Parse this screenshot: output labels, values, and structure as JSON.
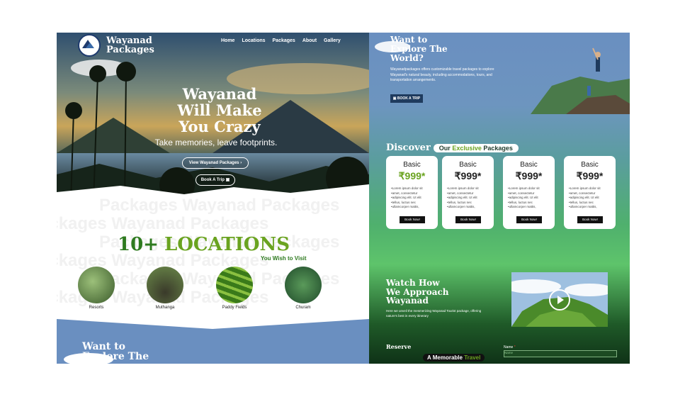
{
  "brand": {
    "name_line1": "Wayanad",
    "name_line2": "Packages"
  },
  "nav": [
    "Home",
    "Locations",
    "Packages",
    "About",
    "Gallery"
  ],
  "hero": {
    "title_line1": "Wayanad",
    "title_line2": "Will Make",
    "title_line3": "You Crazy",
    "subtitle": "Take memories, leave footprints.",
    "view_button": "View Wayanad Packages",
    "book_button": "Book A Trip"
  },
  "locations": {
    "watermark": "Packages Wayanad Packages",
    "count": "10+",
    "word": "LOCATIONS",
    "tagline": "You Wish to Visit",
    "items": [
      {
        "label": "Resorts",
        "color": "#5c8a4a"
      },
      {
        "label": "Muthanga",
        "color": "#6b6a3a"
      },
      {
        "label": "Paddy Fields",
        "color": "#4f8a2a"
      },
      {
        "label": "Churam",
        "color": "#2f6a3a"
      }
    ]
  },
  "left_footer_title": {
    "line1": "Want to",
    "line2": "Explore The"
  },
  "explore": {
    "title_line1": "Want to",
    "title_line2": "Explore The",
    "title_line3": "World?",
    "description": "Wayanadpackages offers customizable travel packages to explore Wayanad's natural beauty, including accommodations, tours, and transportation arrangements.",
    "button": "BOOK A TRIP"
  },
  "discover": {
    "word": "Discover",
    "pill_our": "Our",
    "pill_exclusive": "Exclusive",
    "pill_packages": "Packages"
  },
  "packages": [
    {
      "title": "Basic",
      "price": "₹999*",
      "price_color": "#6aa320",
      "features": [
        "Lorem ipsum dolor sit",
        "amet, consectetur",
        "adipiscing elit. Ut elit",
        "tellus, luctus nec",
        "ullamcorper mattis,"
      ],
      "button": "Book Now!"
    },
    {
      "title": "Basic",
      "price": "₹999*",
      "price_color": "#222222",
      "features": [
        "Lorem ipsum dolor sit",
        "amet, consectetur",
        "adipiscing elit. Ut elit",
        "tellus, luctus nec",
        "ullamcorper mattis,"
      ],
      "button": "Book Now!"
    },
    {
      "title": "Basic",
      "price": "₹999*",
      "price_color": "#222222",
      "features": [
        "Lorem ipsum dolor sit",
        "amet, consectetur",
        "adipiscing elit. Ut elit",
        "tellus, luctus nec",
        "ullamcorper mattis,"
      ],
      "button": "Book Now!"
    },
    {
      "title": "Basic",
      "price": "₹999*",
      "price_color": "#222222",
      "features": [
        "Lorem ipsum dolor sit",
        "amet, consectetur",
        "adipiscing elit. Ut elit",
        "tellus, luctus nec",
        "ullamcorper mattis,"
      ],
      "button": "Book Now!"
    }
  ],
  "watch": {
    "line1": "Watch How",
    "line2": "We Approach",
    "line3": "Wayanad",
    "description": "Here we unveil the mesmerizing Wayanad Tourist package, offering nature's best in every itinerary"
  },
  "reserve": {
    "title": "Reserve",
    "pill_a": "A",
    "pill_memorable": "Memorable",
    "pill_travel": "Travel",
    "name_label": "Name",
    "name_required": "*"
  },
  "colors": {
    "brand_green": "#6aa320",
    "dark_green": "#2e7a1f",
    "sky_blue": "#6a8fc0",
    "navy": "#1f3b5e"
  }
}
